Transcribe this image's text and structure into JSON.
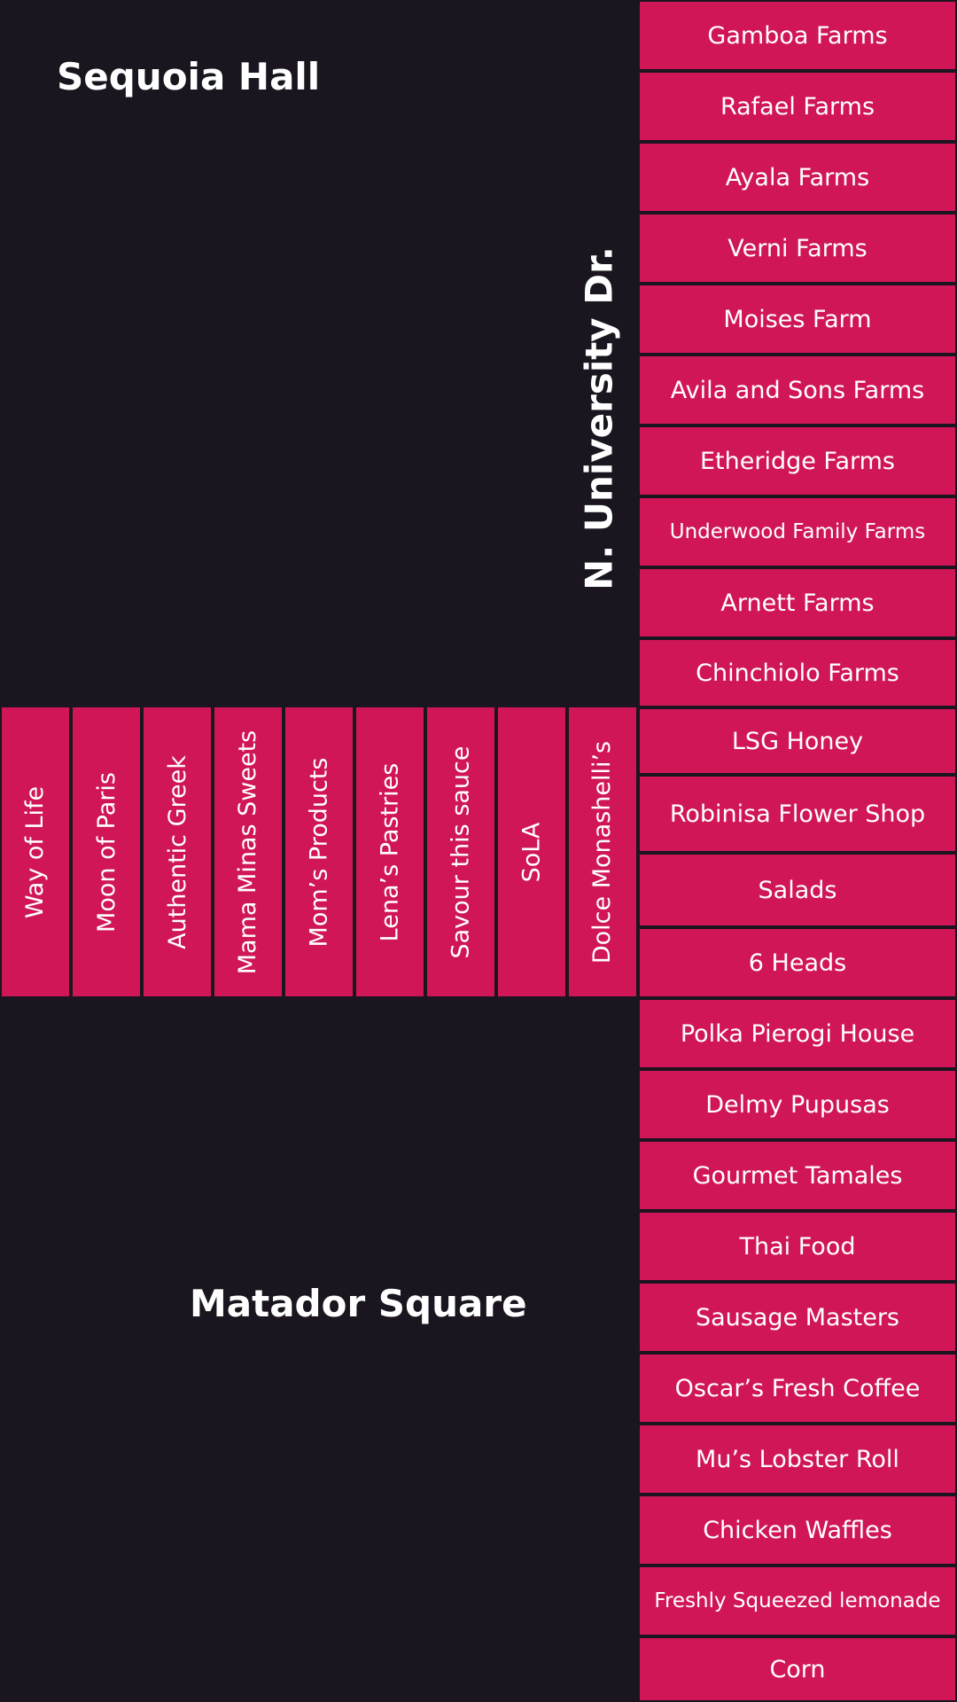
{
  "areas": {
    "sequoia_hall": "Sequoia Hall",
    "matador_square": "Matador Square",
    "street": "N. University Dr."
  },
  "colors": {
    "background": "#1a151e",
    "stall": "#d01657",
    "text": "#ffffff"
  },
  "right_column": [
    "Gamboa Farms",
    "Rafael Farms",
    "Ayala Farms",
    "Verni Farms",
    "Moises Farm",
    "Avila and Sons Farms",
    "Etheridge Farms",
    "Underwood Family Farms",
    "Arnett Farms",
    "Chinchiolo Farms",
    "LSG Honey",
    "Robinisa Flower Shop",
    "Salads",
    "6 Heads",
    "Polka Pierogi House",
    "Delmy Pupusas",
    "Gourmet Tamales",
    "Thai Food",
    "Sausage Masters",
    "Oscar’s Fresh Coffee",
    "Mu’s Lobster Roll",
    "Chicken Waffles",
    "Freshly Squeezed lemonade",
    "Corn"
  ],
  "middle_row": [
    "Way of Life",
    "Moon of Paris",
    "Authentic Greek",
    "Mama Minas Sweets",
    "Mom’s Products",
    "Lena’s Pastries",
    "Savour this sauce",
    "SoLA",
    "Dolce Monashelli’s"
  ]
}
